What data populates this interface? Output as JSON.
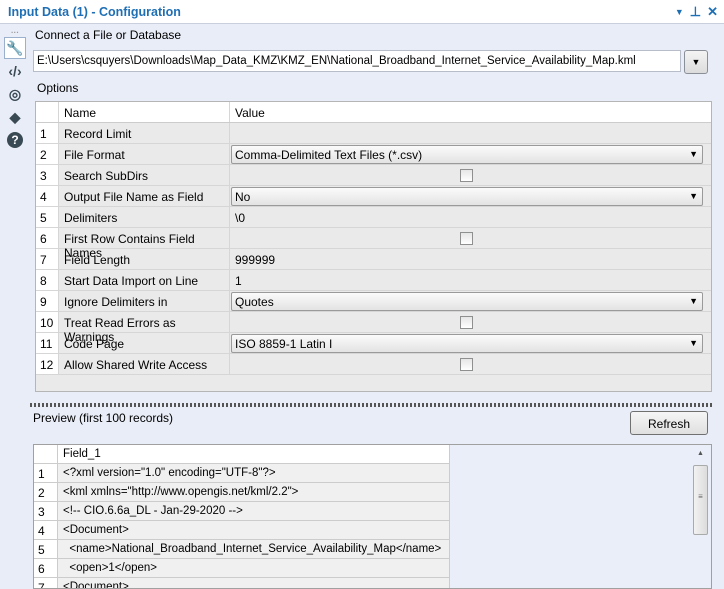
{
  "window": {
    "title": "Input Data (1) - Configuration"
  },
  "connect": {
    "label": "Connect a File or Database",
    "path": "E:\\Users\\csquyers\\Downloads\\Map_Data_KMZ\\KMZ_EN\\National_Broadband_Internet_Service_Availability_Map.kml"
  },
  "options": {
    "label": "Options",
    "headers": {
      "name": "Name",
      "value": "Value"
    },
    "rows": [
      {
        "n": "1",
        "name": "Record Limit",
        "value": "",
        "type": "text"
      },
      {
        "n": "2",
        "name": "File Format",
        "value": "Comma-Delimited Text Files (*.csv)",
        "type": "select"
      },
      {
        "n": "3",
        "name": "Search SubDirs",
        "checked": false,
        "type": "check"
      },
      {
        "n": "4",
        "name": "Output File Name as Field",
        "value": "No",
        "type": "select"
      },
      {
        "n": "5",
        "name": "Delimiters",
        "value": "\\0",
        "type": "text"
      },
      {
        "n": "6",
        "name": "First Row Contains Field Names",
        "checked": false,
        "type": "check"
      },
      {
        "n": "7",
        "name": "Field Length",
        "value": "999999",
        "type": "text"
      },
      {
        "n": "8",
        "name": "Start Data Import on Line",
        "value": "1",
        "type": "text"
      },
      {
        "n": "9",
        "name": "Ignore Delimiters in",
        "value": "Quotes",
        "type": "select"
      },
      {
        "n": "10",
        "name": "Treat Read Errors as Warnings",
        "checked": false,
        "type": "check"
      },
      {
        "n": "11",
        "name": "Code Page",
        "value": "ISO 8859-1 Latin I",
        "type": "select"
      },
      {
        "n": "12",
        "name": "Allow Shared Write Access",
        "checked": false,
        "type": "check"
      }
    ]
  },
  "preview": {
    "label": "Preview (first 100 records)",
    "refresh_label": "Refresh",
    "column": "Field_1",
    "rows": [
      {
        "n": "1",
        "v": "<?xml version=\"1.0\" encoding=\"UTF-8\"?>"
      },
      {
        "n": "2",
        "v": "<kml xmlns=\"http://www.opengis.net/kml/2.2\">"
      },
      {
        "n": "3",
        "v": "<!-- CIO.6.6a_DL - Jan-29-2020 -->"
      },
      {
        "n": "4",
        "v": "<Document>"
      },
      {
        "n": "5",
        "v": "  <name>National_Broadband_Internet_Service_Availability_Map</name>"
      },
      {
        "n": "6",
        "v": "  <open>1</open>"
      },
      {
        "n": "7",
        "v": "<Document>"
      }
    ]
  },
  "icons": {
    "toolbar": [
      "wrench-icon",
      "code-icon",
      "compass-icon",
      "tag-icon",
      "help-icon"
    ]
  },
  "colors": {
    "title": "#1f6fb5",
    "background": "#e9edf7"
  }
}
